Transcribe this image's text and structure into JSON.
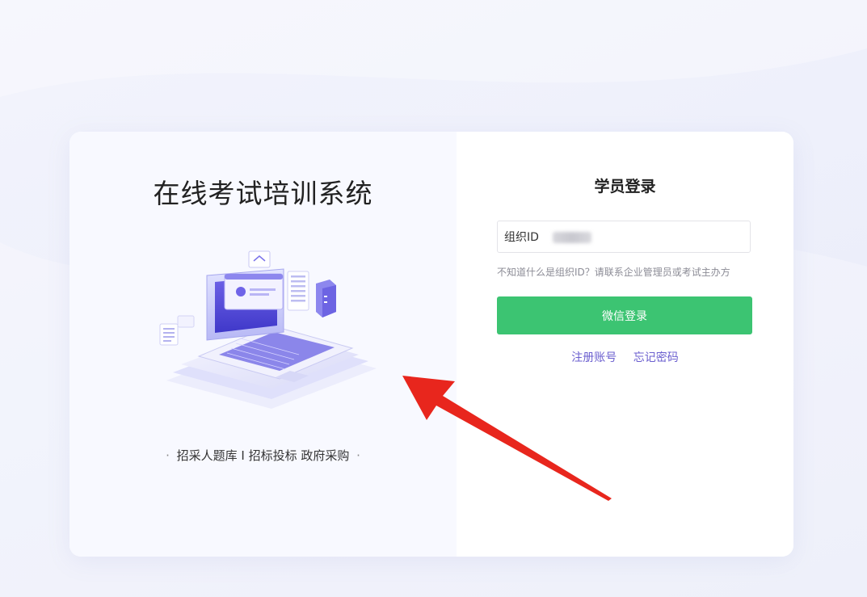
{
  "left": {
    "title": "在线考试培训系统",
    "tagline_prefix": "·",
    "tagline": "招采人题库 I 招标投标 政府采购",
    "tagline_suffix": "·"
  },
  "login": {
    "title": "学员登录",
    "org_label": "组织ID",
    "org_value": "",
    "hint": "不知道什么是组织ID？请联系企业管理员或考试主办方",
    "wechat_button": "微信登录",
    "register_link": "注册账号",
    "forgot_link": "忘记密码"
  },
  "colors": {
    "primary_button": "#3cc472",
    "link": "#6b5fcf",
    "annotation_arrow": "#e8261d"
  },
  "icons": [
    "laptop-illustration",
    "annotation-arrow"
  ]
}
